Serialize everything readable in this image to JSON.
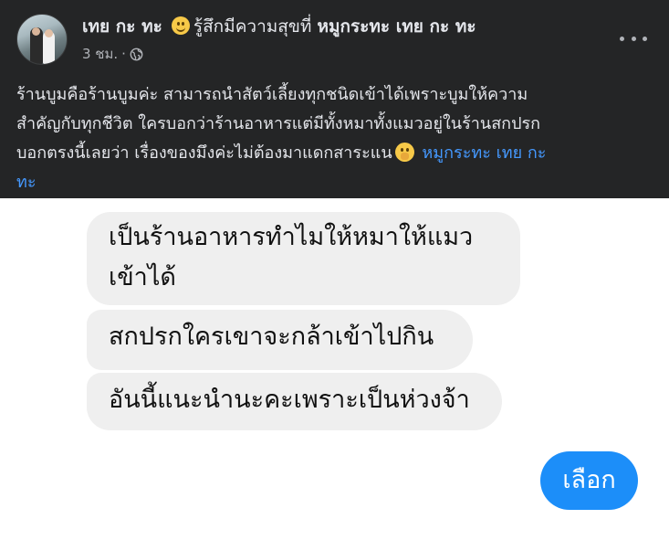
{
  "post": {
    "author_name": "เทย กะ ทะ",
    "feeling_text": "รู้สึกมีความสุขที่",
    "feeling_icon": "smile-emoji",
    "page_name": "หมูกระทะ เทย กะ ทะ",
    "time": "3 ชม.",
    "privacy_icon": "globe-icon",
    "more_icon": "more-options-icon",
    "text_lines": [
      "ร้านบูมคือร้านบูมค่ะ สามารถนำสัตว์เลี้ยงทุกชนิดเข้าได้เพราะบูมให้ความ",
      "สำคัญกับทุกชีวิต ใครบอกว่าร้านอาหารแต่มีทั้งหมาทั้งแมวอยู่ในร้านสกปรก",
      "บอกตรงนี้เลยว่า เรื่องของมึงค่ะไม่ต้องมาแดกสาระแน"
    ],
    "text_emoji": "shushing-face-emoji",
    "mention_part1": "หมูกระทะ เทย กะ",
    "mention_part2": "ทะ"
  },
  "chat": {
    "bubble1_line1": "เป็นร้านอาหารทำไมให้หมาให้แมว",
    "bubble1_line2": "เข้าได้",
    "bubble2": "สกปรกใครเขาจะกล้าเข้าไปกิน",
    "bubble3": "อันนี้แนะนำนะคะเพราะเป็นห่วงจ้า",
    "choose_button": "เลือก"
  },
  "colors": {
    "post_background": "#242526",
    "post_text": "#e4e6eb",
    "secondary_text": "#b0b3b8",
    "mention": "#4599ff",
    "bubble_background": "#efefef",
    "button_blue": "#1c8ef9"
  }
}
